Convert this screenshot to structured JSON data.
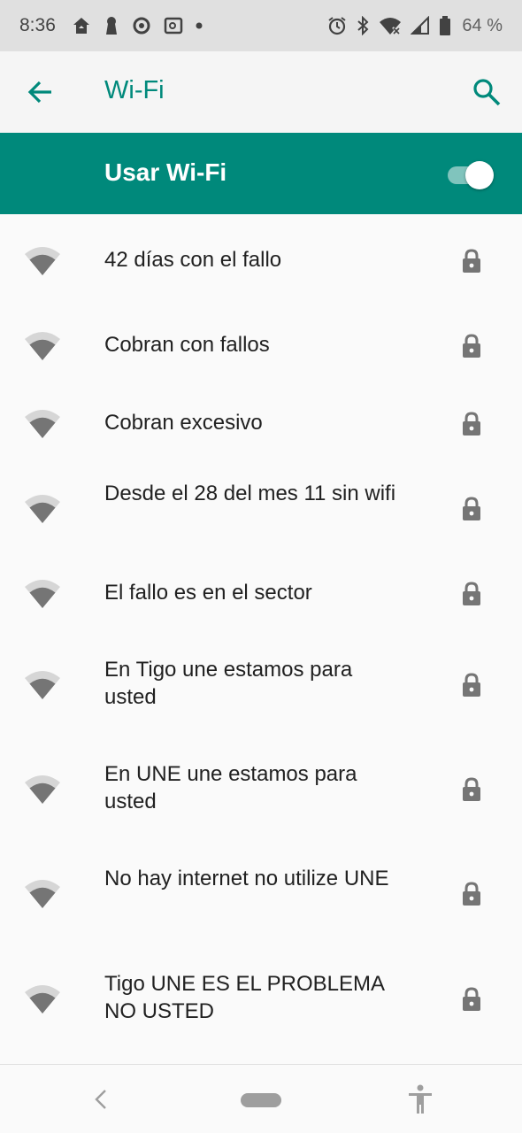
{
  "status_bar": {
    "time": "8:36",
    "battery_text": "64 %",
    "left_icons": [
      "home-notification-icon",
      "keyhole-icon",
      "sync-icon",
      "safe-icon",
      "dot-icon"
    ],
    "right_icons": [
      "alarm-icon",
      "bluetooth-icon",
      "wifi-status-icon",
      "cell-signal-icon",
      "battery-icon"
    ]
  },
  "app_bar": {
    "title": "Wi-Fi",
    "back_icon": "arrow-back-icon",
    "search_icon": "search-icon"
  },
  "master_switch": {
    "label": "Usar Wi-Fi",
    "enabled": true
  },
  "networks": [
    {
      "name": "42 días con el fallo",
      "secured": true
    },
    {
      "name": "Cobran con fallos",
      "secured": true
    },
    {
      "name": "Cobran excesivo",
      "secured": true
    },
    {
      "name": "Desde el 28 del mes 11 sin wifi",
      "secured": true
    },
    {
      "name": "El fallo es en el sector",
      "secured": true
    },
    {
      "name": "En Tigo une estamos para usted",
      "secured": true
    },
    {
      "name": "En UNE une estamos para usted",
      "secured": true
    },
    {
      "name": "No hay internet no utilize UNE",
      "secured": true
    },
    {
      "name": "Tigo UNE ES EL PROBLEMA NO USTED",
      "secured": true
    }
  ],
  "colors": {
    "accent": "#00897b",
    "app_bar_bg": "#f5f5f5",
    "status_bar_bg": "#e0e0e0",
    "icon_gray": "#757575"
  }
}
